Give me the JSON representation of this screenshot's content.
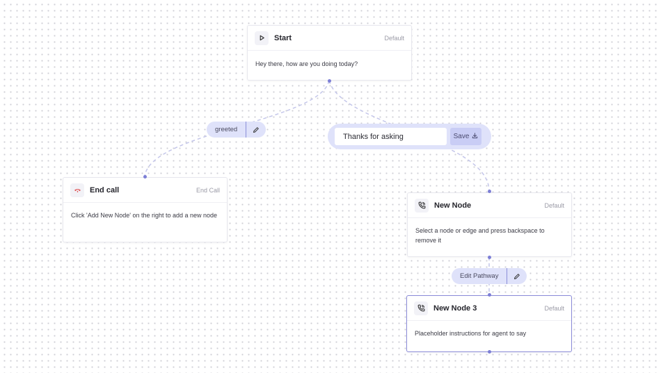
{
  "colors": {
    "edge": "#c4c6ea",
    "handle": "#7d7fd6",
    "pill_bg": "#dfe2fa",
    "selected_border": "#8a8ad8",
    "end_call_icon": "#e05050"
  },
  "nodes": {
    "start": {
      "title": "Start",
      "tag": "Default",
      "text": "Hey there, how are you doing today?",
      "icon": "play-icon"
    },
    "end_call": {
      "title": "End call",
      "tag": "End Call",
      "text": "Click 'Add New Node' on the right to add a new node",
      "icon": "hang-up-icon"
    },
    "new_node": {
      "title": "New Node",
      "tag": "Default",
      "text": "Select a node or edge and press backspace to remove it",
      "icon": "phone-icon"
    },
    "new_node_3": {
      "title": "New Node 3",
      "tag": "Default",
      "text": "Placeholder instructions for agent to say",
      "icon": "phone-icon"
    }
  },
  "edges": {
    "greeted": {
      "label": "greeted",
      "icon": "pencil-icon"
    },
    "edit_pathway": {
      "label": "Edit Pathway",
      "icon": "pencil-icon"
    },
    "editing": {
      "value": "Thanks for asking",
      "save_label": "Save",
      "save_icon": "download-icon"
    }
  }
}
